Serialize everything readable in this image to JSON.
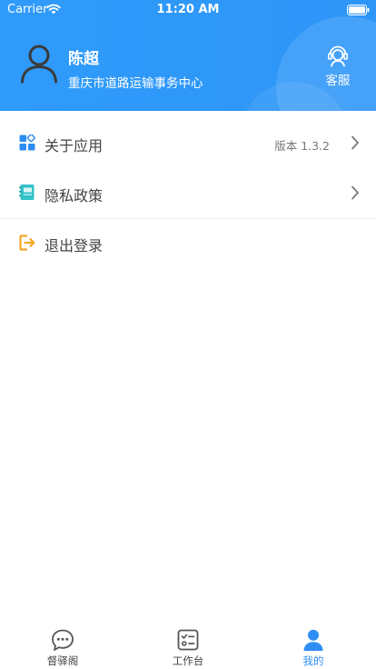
{
  "status_bar": {
    "carrier": "Carrier",
    "time": "11:20 AM",
    "wifi_icon": "wifi-icon",
    "battery_icon": "battery-icon"
  },
  "header": {
    "background_color": "#2f9bfb",
    "user": {
      "name": "陈超",
      "organization": "重庆市道路运输事务中心",
      "avatar_icon": "user-avatar-icon"
    },
    "service": {
      "label": "客服",
      "icon": "headset-icon"
    }
  },
  "menu": {
    "items": [
      {
        "label": "关于应用",
        "value": "版本 1.3.2",
        "icon": "apps-grid-icon",
        "has_chevron": true
      },
      {
        "label": "隐私政策",
        "value": "",
        "icon": "notebook-icon",
        "has_chevron": true
      },
      {
        "label": "退出登录",
        "value": "",
        "icon": "logout-icon",
        "has_chevron": false
      }
    ]
  },
  "tabbar": {
    "active_color": "#2f8ef5",
    "tabs": [
      {
        "label": "督驿阁",
        "icon": "chat-bubble-icon",
        "active": false
      },
      {
        "label": "工作台",
        "icon": "checklist-icon",
        "active": false
      },
      {
        "label": "我的",
        "icon": "person-icon",
        "active": true
      }
    ]
  }
}
